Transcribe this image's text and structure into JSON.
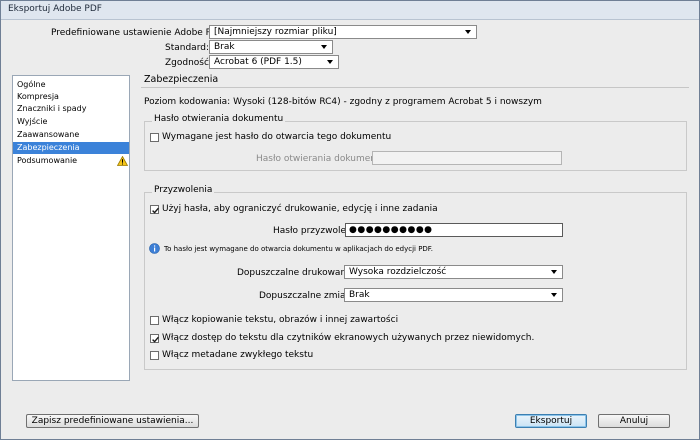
{
  "window": {
    "title": "Eksportuj Adobe PDF"
  },
  "top": {
    "preset_label": "Predefiniowane ustawienie Adobe PDF:",
    "preset_value": "[Najmniejszy rozmiar pliku]",
    "standard_label": "Standard:",
    "standard_value": "Brak",
    "compat_label": "Zgodność:",
    "compat_value": "Acrobat 6 (PDF 1.5)"
  },
  "sidebar": {
    "items": [
      {
        "label": "Ogólne"
      },
      {
        "label": "Kompresja"
      },
      {
        "label": "Znaczniki i spady"
      },
      {
        "label": "Wyjście"
      },
      {
        "label": "Zaawansowane"
      },
      {
        "label": "Zabezpieczenia"
      },
      {
        "label": "Podsumowanie"
      }
    ]
  },
  "section": {
    "title": "Zabezpieczenia",
    "encryption_level": "Poziom kodowania: Wysoki (128-bitów RC4) - zgodny z programem Acrobat 5 i nowszym"
  },
  "open_password": {
    "legend": "Hasło otwierania dokumentu",
    "checkbox_label": "Wymagane jest hasło do otwarcia tego dokumentu",
    "field_label": "Hasło otwierania dokumentu:",
    "field_value": ""
  },
  "permissions": {
    "legend": "Przyzwolenia",
    "use_password_label": "Użyj hasła, aby ograniczyć drukowanie, edycję i inne zadania",
    "password_label": "Hasło przyzwoleń:",
    "password_value": "●●●●●●●●●●",
    "info_text": "To hasło jest wymagane do otwarcia dokumentu w aplikacjach do edycji PDF.",
    "printing_label": "Dopuszczalne drukowanie:",
    "printing_value": "Wysoka rozdzielczość",
    "changes_label": "Dopuszczalne zmiany:",
    "changes_value": "Brak",
    "copy_label": "Włącz kopiowanie tekstu, obrazów i innej zawartości",
    "screenreader_label": "Włącz dostęp do tekstu dla czytników ekranowych używanych przez niewidomych.",
    "metadata_label": "Włącz metadane zwykłego tekstu"
  },
  "buttons": {
    "save_preset": "Zapisz predefiniowane ustawienia...",
    "export": "Eksportuj",
    "cancel": "Anuluj"
  },
  "colors": {
    "selection": "#3b82d9",
    "primary_button_border": "#3c7fb1"
  }
}
